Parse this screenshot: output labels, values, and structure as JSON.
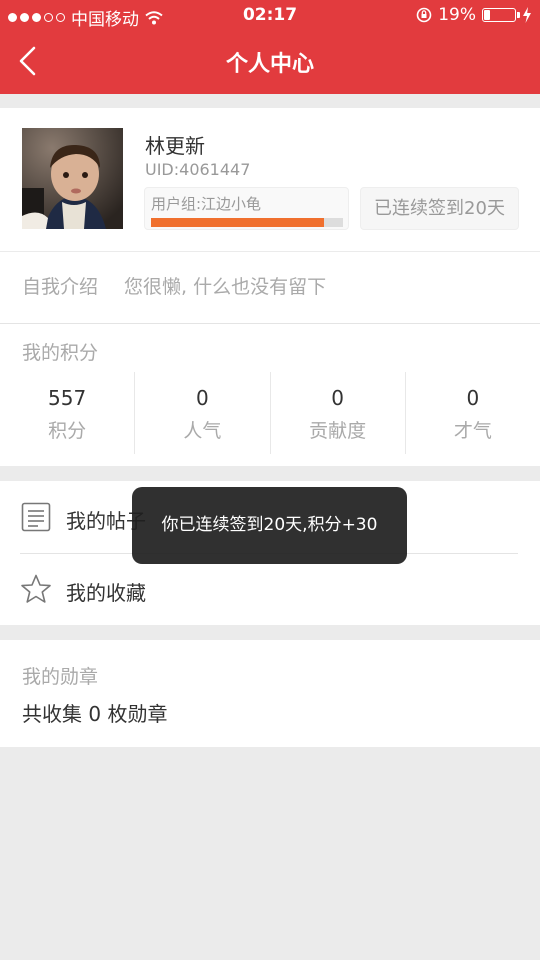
{
  "status_bar": {
    "carrier": "中国移动",
    "time": "02:17",
    "battery_text": "19%",
    "battery_level": 0.19,
    "signal_dots_on": 3,
    "signal_dots_total": 5
  },
  "nav": {
    "title": "个人中心"
  },
  "profile": {
    "name": "林更新",
    "uid": "UID:4061447",
    "group": "用户组:江边小龟",
    "group_progress": 0.9,
    "sign_label": "已连续签到20天"
  },
  "intro": {
    "label": "自我介绍",
    "text": "您很懒, 什么也没有留下"
  },
  "points": {
    "title": "我的积分",
    "stats": [
      {
        "value": "557",
        "label": "积分"
      },
      {
        "value": "0",
        "label": "人气"
      },
      {
        "value": "0",
        "label": "贡献度"
      },
      {
        "value": "0",
        "label": "才气"
      }
    ]
  },
  "menu": {
    "posts": "我的帖子",
    "favorites": "我的收藏"
  },
  "medals": {
    "title": "我的勋章",
    "summary": "共收集 0 枚勋章"
  },
  "toast": {
    "message": "你已连续签到20天,积分+30"
  },
  "colors": {
    "brand": "#e23b3e",
    "progress": "#f0702e"
  }
}
